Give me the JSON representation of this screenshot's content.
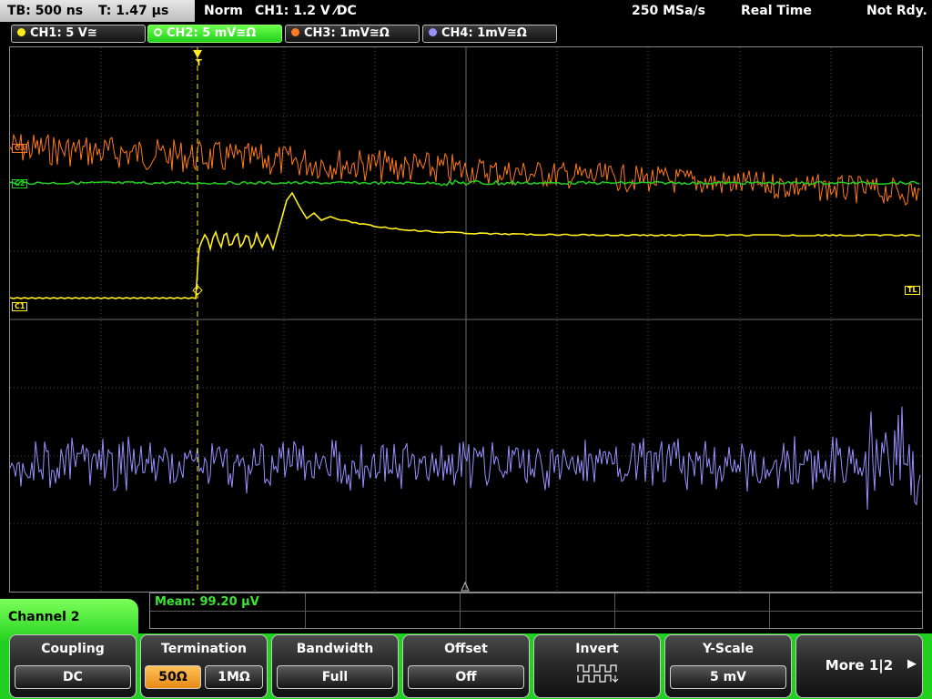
{
  "status_bar": {
    "timebase": "TB: 500 ns",
    "trigger_time": "T: 1.47 µs",
    "trigger_mode": "Norm",
    "trigger_info": "CH1: 1.2 V ⁄DC",
    "sample_rate": "250 MSa/s",
    "acq_mode": "Real Time",
    "state": "Not Rdy."
  },
  "channels": [
    {
      "label": "CH1: 5 V≅",
      "color": "#ffee1a"
    },
    {
      "label": "CH2: 5 mV≅Ω",
      "color": "#21d01e"
    },
    {
      "label": "CH3: 1mV≅Ω",
      "color": "#ff7a1e"
    },
    {
      "label": "CH4: 1mV≅Ω",
      "color": "#9a90ff"
    }
  ],
  "screen_markers": {
    "ch1_level": "C1",
    "ch2_level": "C2",
    "ch3_level": "C3",
    "trigger_level": "TL",
    "trigger_point": "T"
  },
  "measurement": {
    "text": "Mean: 99.20 µV"
  },
  "menu": {
    "title": "Channel 2",
    "coupling": {
      "label": "Coupling",
      "value": "DC"
    },
    "termination": {
      "label": "Termination",
      "options": [
        "50Ω",
        "1MΩ"
      ],
      "selected": "50Ω"
    },
    "bandwidth": {
      "label": "Bandwidth",
      "value": "Full"
    },
    "offset": {
      "label": "Offset",
      "value": "Off"
    },
    "invert": {
      "label": "Invert"
    },
    "yscale": {
      "label": "Y-Scale",
      "value": "5 mV"
    },
    "more": {
      "label": "More 1|2"
    }
  },
  "colors": {
    "ch1": "#ffee1a",
    "ch2": "#21d01e",
    "ch3": "#ff7a1e",
    "ch4": "#9a90ff",
    "grid": "#4a4a4a",
    "accent_selected": "#e98a15"
  }
}
